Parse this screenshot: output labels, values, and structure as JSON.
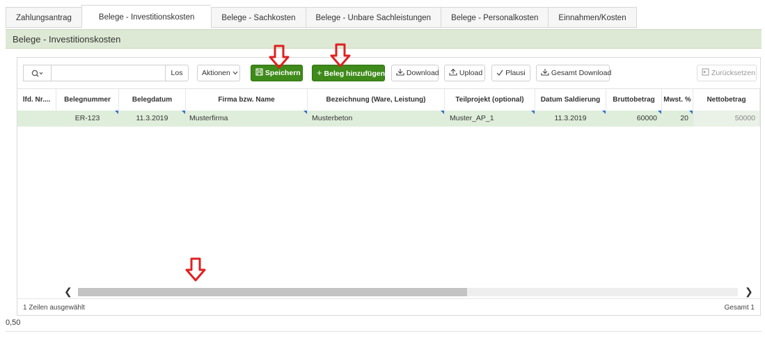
{
  "tabs": [
    {
      "label": "Zahlungsantrag",
      "active": false
    },
    {
      "label": "Belege - Investitionskosten",
      "active": true
    },
    {
      "label": "Belege - Sachkosten",
      "active": false
    },
    {
      "label": "Belege - Unbare Sachleistungen",
      "active": false
    },
    {
      "label": "Belege - Personalkosten",
      "active": false
    },
    {
      "label": "Einnahmen/Kosten",
      "active": false
    }
  ],
  "section_title": "Belege - Investitionskosten",
  "toolbar": {
    "search_icon": "search-icon",
    "search_value": "",
    "go_label": "Los",
    "actions_label": "Aktionen",
    "save_label": "Speichern",
    "add_label": "Beleg hinzufügen",
    "download_label": "Download",
    "upload_label": "Upload",
    "plausi_label": "Plausi",
    "total_download_label": "Gesamt Download",
    "reset_label": "Zurücksetzen"
  },
  "columns": [
    "lfd. Nr....",
    "Belegnummer",
    "Belegdatum",
    "Firma bzw. Name",
    "Bezeichnung (Ware, Leistung)",
    "Teilprojekt (optional)",
    "Datum Saldierung",
    "Bruttobetrag",
    "Mwst. %",
    "Nettobetrag"
  ],
  "rows": [
    {
      "lfd": "",
      "belegnummer": "ER-123",
      "belegdatum": "11.3.2019",
      "firma": "Musterfirma",
      "bezeichnung": "Musterbeton",
      "teilprojekt": "Muster_AP_1",
      "datum_saldierung": "11.3.2019",
      "brutto": "60000",
      "mwst": "20",
      "netto": "50000"
    }
  ],
  "scroll": {
    "thumb_fraction": 0.59
  },
  "footer": {
    "selected": "1 Zeilen ausgewählt",
    "total": "Gesamt 1"
  },
  "below_value": "0,50",
  "colors": {
    "accent_green": "#3e8a1a",
    "band": "#dde9d4",
    "row_selected": "#dfeedb",
    "annotation_red": "#e02020"
  }
}
